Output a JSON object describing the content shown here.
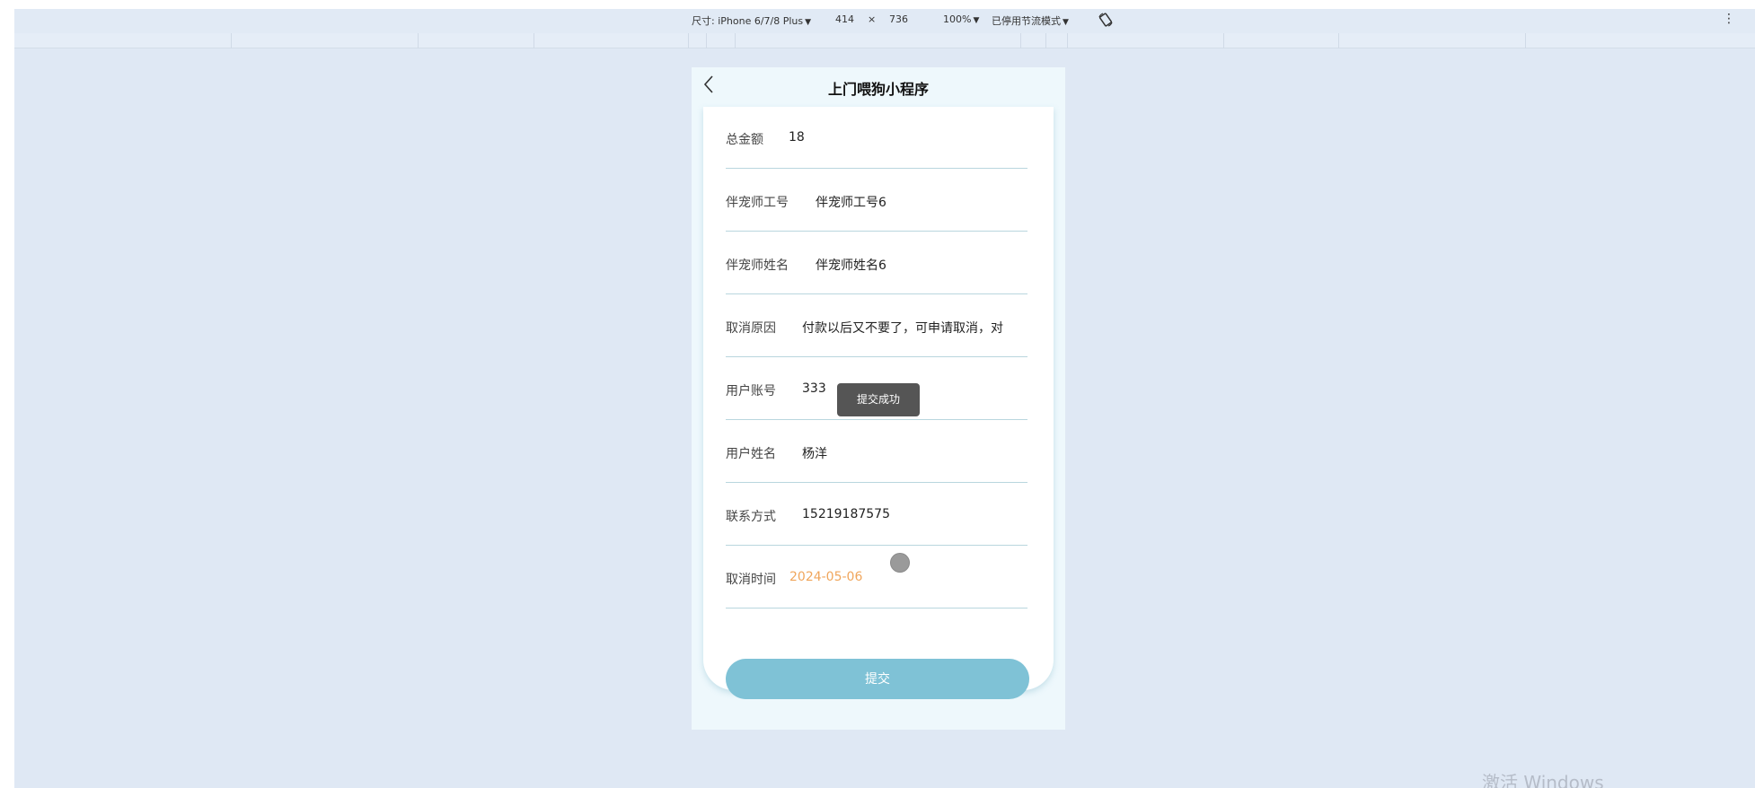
{
  "devtools": {
    "device_label": "尺寸: iPhone 6/7/8 Plus",
    "width": "414",
    "times": "×",
    "height": "736",
    "zoom": "100%",
    "throttle": "已停用节流模式",
    "caret": "▼",
    "more": "⋮"
  },
  "app": {
    "title": "上门喂狗小程序",
    "back": "‹"
  },
  "form": {
    "rows": [
      {
        "label": "总金额",
        "value": "18"
      },
      {
        "label": "伴宠师工号",
        "value": "伴宠师工号6"
      },
      {
        "label": "伴宠师姓名",
        "value": "伴宠师姓名6"
      },
      {
        "label": "取消原因",
        "value": "付款以后又不要了，可申请取消，对"
      },
      {
        "label": "用户账号",
        "value": "333"
      },
      {
        "label": "用户姓名",
        "value": "杨洋"
      },
      {
        "label": "联系方式",
        "value": "15219187575"
      },
      {
        "label": "取消时间",
        "value": "2024-05-06"
      }
    ],
    "submit_label": "提交"
  },
  "toast": "提交成功",
  "watermark": "激活 Windows",
  "colors": {
    "background": "#dfe8f4",
    "button": "#7fc2d6",
    "date": "#f0a65c",
    "toast": "#555555"
  }
}
